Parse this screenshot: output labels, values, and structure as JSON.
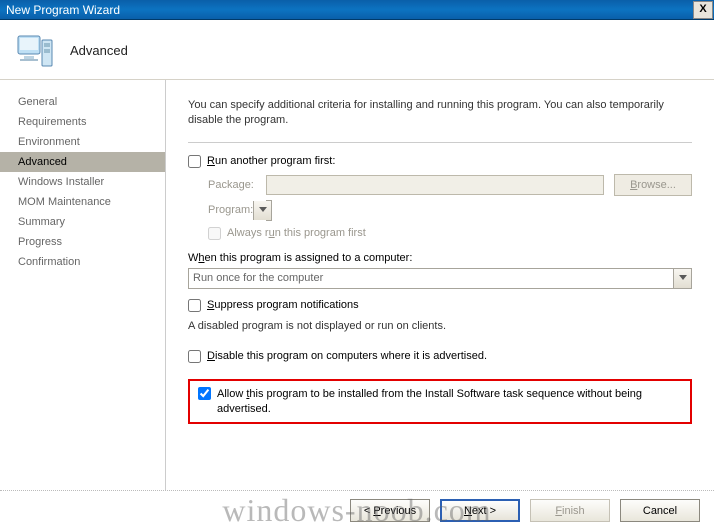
{
  "window": {
    "title": "New Program Wizard",
    "close": "X"
  },
  "banner": {
    "heading": "Advanced"
  },
  "sidebar": {
    "items": [
      {
        "label": "General",
        "selected": false
      },
      {
        "label": "Requirements",
        "selected": false
      },
      {
        "label": "Environment",
        "selected": false
      },
      {
        "label": "Advanced",
        "selected": true
      },
      {
        "label": "Windows Installer",
        "selected": false
      },
      {
        "label": "MOM Maintenance",
        "selected": false
      },
      {
        "label": "Summary",
        "selected": false
      },
      {
        "label": "Progress",
        "selected": false
      },
      {
        "label": "Confirmation",
        "selected": false
      }
    ]
  },
  "main": {
    "description": "You can specify additional criteria for installing and running this program. You can also temporarily disable the program.",
    "run_first": {
      "label_pre": "R",
      "label_post": "un another program first:",
      "package_label": "Package:",
      "program_label": "Program:",
      "browse": "Browse...",
      "always_pre": "Always r",
      "always_mid": "u",
      "always_post": "n this program first"
    },
    "assigned": {
      "label_pre": "W",
      "label_mid": "h",
      "label_post": "en this program is assigned to a computer:",
      "value": "Run once for the computer"
    },
    "suppress": {
      "mid": "S",
      "post": "uppress program notifications"
    },
    "disabled_note": "A disabled program is not displayed or run on clients.",
    "disable": {
      "mid": "D",
      "post": "isable this program on computers where it is advertised."
    },
    "allow": {
      "pre": "Allow ",
      "mid": "t",
      "post": "his program to be installed from the Install Software task sequence without being advertised."
    }
  },
  "footer": {
    "previous_pre": "< ",
    "previous_mid": "P",
    "previous_post": "revious",
    "next_mid": "N",
    "next_post": "ext >",
    "finish_mid": "F",
    "finish_post": "inish",
    "cancel": "Cancel"
  },
  "watermark": "windows-noob.com"
}
